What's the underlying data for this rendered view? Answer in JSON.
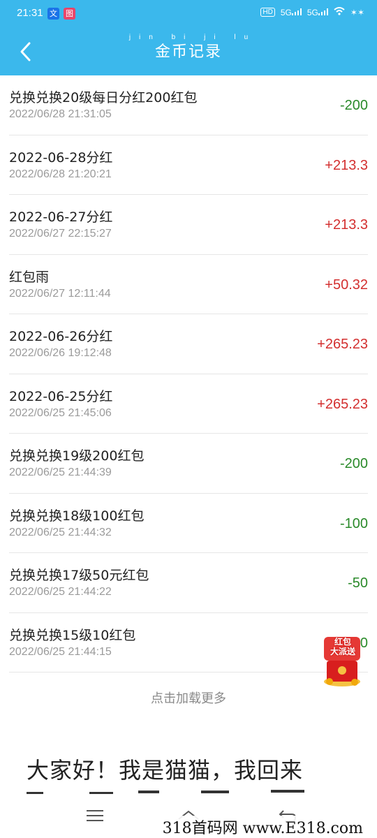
{
  "status": {
    "time": "21:31",
    "notif_a": "文",
    "notif_b": "图",
    "hd": "HD",
    "net1": "5G",
    "net2": "5G"
  },
  "header": {
    "pinyin": "jin bi ji lu",
    "title": "金币记录"
  },
  "records": [
    {
      "title": "兑换兑换20级每日分红200红包",
      "time": "2022/06/28 21:31:05",
      "amount": "-200",
      "sign": "neg"
    },
    {
      "title": "2022-06-28分红",
      "time": "2022/06/28 21:20:21",
      "amount": "+213.3",
      "sign": "pos"
    },
    {
      "title": "2022-06-27分红",
      "time": "2022/06/27 22:15:27",
      "amount": "+213.3",
      "sign": "pos"
    },
    {
      "title": "红包雨",
      "time": "2022/06/27 12:11:44",
      "amount": "+50.32",
      "sign": "pos"
    },
    {
      "title": "2022-06-26分红",
      "time": "2022/06/26 19:12:48",
      "amount": "+265.23",
      "sign": "pos"
    },
    {
      "title": "2022-06-25分红",
      "time": "2022/06/25 21:45:06",
      "amount": "+265.23",
      "sign": "pos"
    },
    {
      "title": "兑换兑换19级200红包",
      "time": "2022/06/25 21:44:39",
      "amount": "-200",
      "sign": "neg"
    },
    {
      "title": "兑换兑换18级100红包",
      "time": "2022/06/25 21:44:32",
      "amount": "-100",
      "sign": "neg"
    },
    {
      "title": "兑换兑换17级50元红包",
      "time": "2022/06/25 21:44:22",
      "amount": "-50",
      "sign": "neg"
    },
    {
      "title": "兑换兑换15级10红包",
      "time": "2022/06/25 21:44:15",
      "amount": "-10",
      "sign": "neg"
    }
  ],
  "load_more": "点击加载更多",
  "red_packet_badge": {
    "line1": "红包",
    "line2": "大派送"
  },
  "promo_text": "大家好！我是猫猫，我回来",
  "watermark": "318首码网 www.E318.com",
  "colors": {
    "header": "#3bb8ec",
    "negative": "#2a8a2a",
    "positive": "#d32f2f"
  }
}
